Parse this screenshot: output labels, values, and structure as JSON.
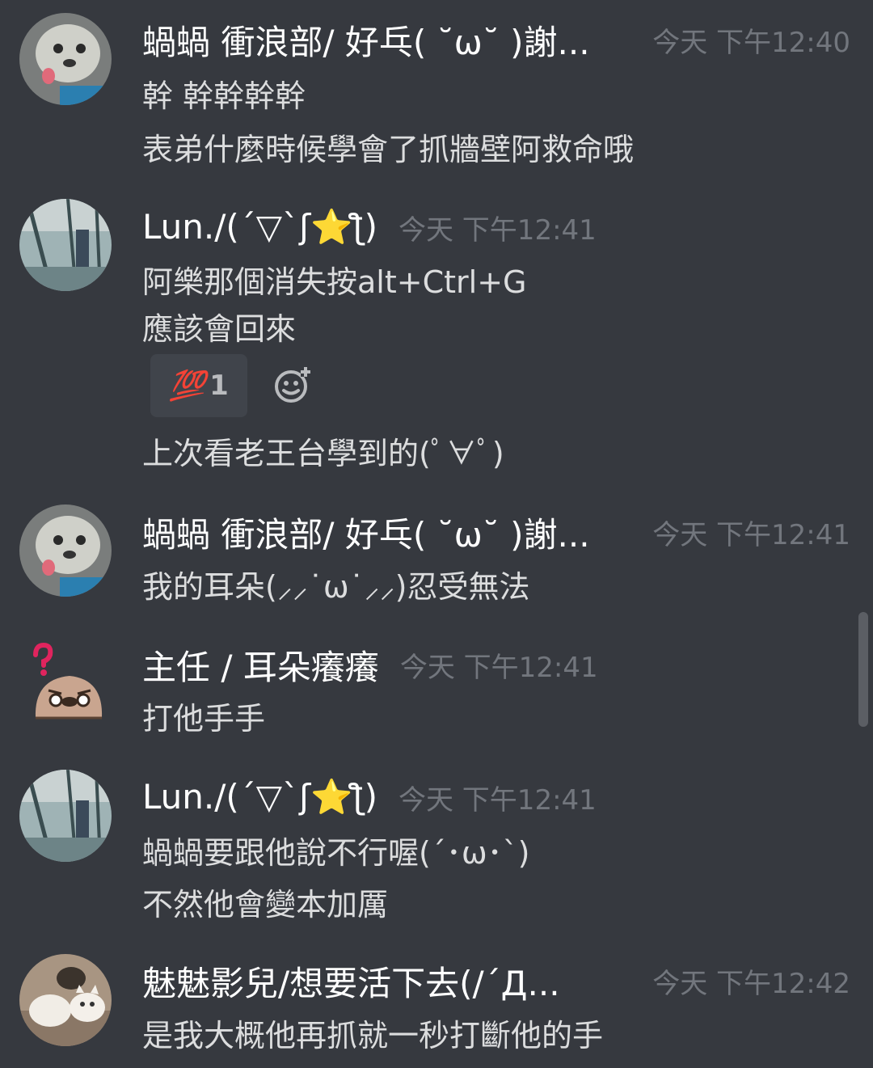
{
  "colors": {
    "background": "#36393f",
    "username": "#ffffff",
    "text": "#dcddde",
    "timestamp": "#72767d",
    "reaction_bg": "#40444b"
  },
  "messages": [
    {
      "avatar_icon": "dog-avatar-icon",
      "username": "蝸蝸 衝浪部/ 好乓( ˘ω˘ )謝...",
      "timestamp": "今天 下午12:40",
      "lines": [
        "幹 幹幹幹幹",
        "表弟什麼時候學會了抓牆壁阿救命哦"
      ]
    },
    {
      "avatar_icon": "building-photo-avatar-icon",
      "username": "Lun./(´▽`ʃ⭐ƪ)",
      "timestamp": "今天 下午12:41",
      "lines": [
        "阿樂那個消失按alt+Ctrl+G",
        "應該會回來",
        "上次看老王台學到的(ﾟ∀ﾟ)"
      ],
      "reaction": {
        "emoji": "💯",
        "emoji_name": "hundred-points-icon",
        "count": "1"
      }
    },
    {
      "avatar_icon": "dog-avatar-icon",
      "username": "蝸蝸 衝浪部/ 好乓( ˘ω˘ )謝...",
      "timestamp": "今天 下午12:41",
      "lines": [
        "我的耳朵(⸝⸝˙ω˙⸝⸝)忍受無法"
      ]
    },
    {
      "avatar_icon": "confused-seal-avatar-icon",
      "username": "主任 / 耳朵癢癢",
      "timestamp": "今天 下午12:41",
      "lines": [
        "打他手手"
      ]
    },
    {
      "avatar_icon": "building-photo-avatar-icon",
      "username": "Lun./(´▽`ʃ⭐ƪ)",
      "timestamp": "今天 下午12:41",
      "lines": [
        "蝸蝸要跟他說不行喔(´･ω･`)",
        "不然他會變本加厲"
      ]
    },
    {
      "avatar_icon": "cats-avatar-icon",
      "username": "魅魅影兒/想要活下去(/´Д...",
      "timestamp": "今天 下午12:42",
      "lines": [
        "是我大概他再抓就一秒打斷他的手"
      ]
    }
  ]
}
